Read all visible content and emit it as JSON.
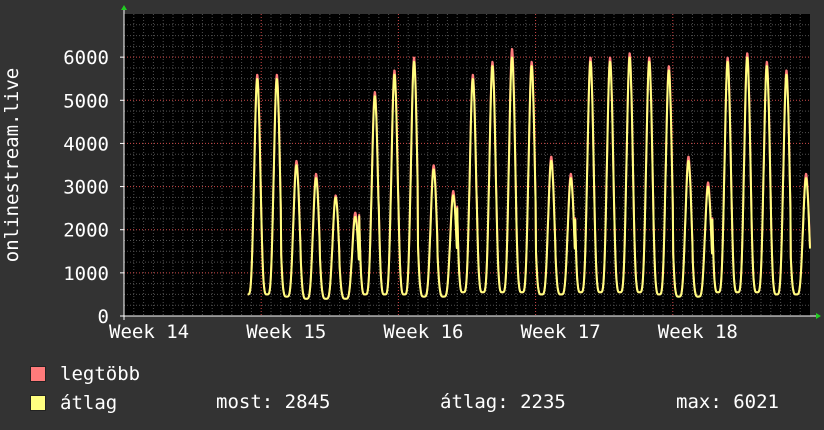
{
  "chart_data": {
    "type": "line",
    "ylabel": "onlinestream.live",
    "ylim": [
      0,
      7000
    ],
    "yticks": [
      0,
      1000,
      2000,
      3000,
      4000,
      5000,
      6000
    ],
    "x_tick_labels": [
      "Week 14",
      "Week 15",
      "Week 16",
      "Week 17",
      "Week 18"
    ],
    "xlim_days": [
      0,
      35
    ],
    "grid": true,
    "colors": {
      "background": "#333333",
      "plot_area": "#000000",
      "grid_minor": "#505050",
      "grid_major": "#d04a4a",
      "series_max": "#ff7b7b",
      "series_avg": "#ffff80"
    },
    "series": [
      {
        "name": "legtöbb",
        "daily_peaks": [
          5600,
          5600,
          3600,
          3300,
          2800,
          2400,
          5200,
          5700,
          6000,
          3500,
          2900,
          5600,
          5900,
          6200,
          5900,
          3700,
          3300,
          6000,
          6000,
          6100,
          6000,
          5800,
          3700,
          3100,
          6000,
          6100,
          5900,
          5700,
          3300
        ],
        "daily_lows": [
          500,
          500,
          450,
          400,
          400,
          400,
          500,
          500,
          500,
          450,
          450,
          550,
          550,
          550,
          550,
          500,
          500,
          550,
          550,
          550,
          550,
          500,
          450,
          450,
          550,
          550,
          550,
          500,
          500
        ]
      },
      {
        "name": "átlag",
        "daily_peaks": [
          5500,
          5500,
          3500,
          3200,
          2750,
          2300,
          5100,
          5600,
          5900,
          3400,
          2800,
          5500,
          5800,
          6000,
          5800,
          3600,
          3200,
          5900,
          5900,
          6000,
          5900,
          5700,
          3600,
          3000,
          5900,
          6000,
          5800,
          5600,
          3200
        ],
        "daily_lows": [
          500,
          500,
          450,
          400,
          400,
          400,
          500,
          500,
          500,
          450,
          450,
          550,
          550,
          550,
          550,
          500,
          500,
          550,
          550,
          550,
          550,
          500,
          450,
          450,
          550,
          550,
          550,
          500,
          500
        ]
      }
    ],
    "gaps_days": [
      [
        4.0,
        4.4
      ],
      [
        6.0,
        6.3
      ]
    ],
    "legend": {
      "max_label": "legtöbb",
      "avg_label": "átlag",
      "now_text": "most: 2845",
      "avg_text": "átlag: 2235",
      "max_text": "max: 6021"
    }
  }
}
